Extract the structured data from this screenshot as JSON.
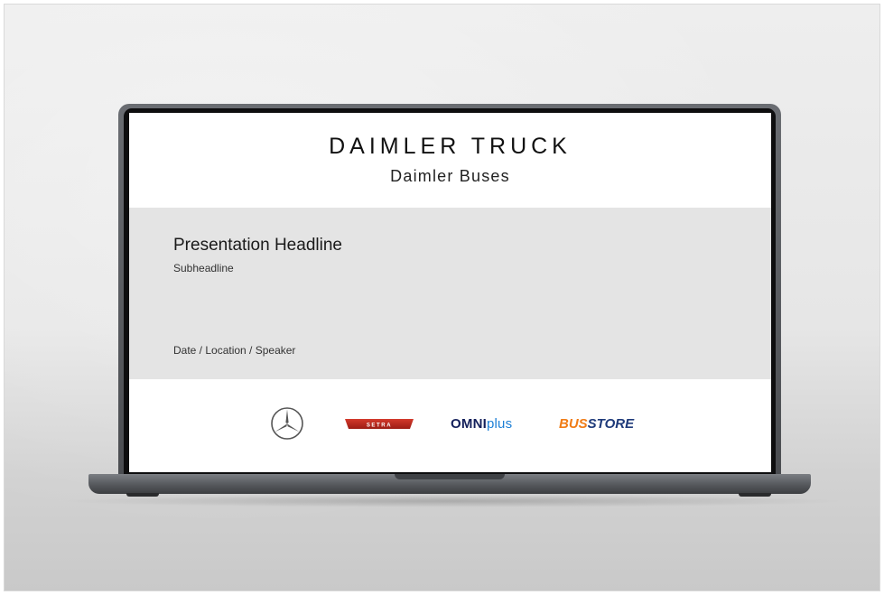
{
  "slide": {
    "brand_title": "DAIMLER TRUCK",
    "brand_subtitle": "Daimler Buses",
    "headline": "Presentation Headline",
    "subheadline": "Subheadline",
    "meta": "Date / Location / Speaker"
  },
  "logos": [
    {
      "name": "mercedes-star-logo",
      "text": ""
    },
    {
      "name": "setra-logo",
      "text": "SETRA"
    },
    {
      "name": "omniplus-logo",
      "text_main": "OMNI",
      "text_accent": "plus"
    },
    {
      "name": "busstore-logo",
      "text_main": "BUS",
      "text_accent": "STORE"
    }
  ],
  "colors": {
    "gray_band": "#e4e4e4",
    "setra_red": "#c0281e",
    "omniplus_navy": "#14205b",
    "omniplus_blue": "#1c7fd6",
    "busstore_orange": "#f07c16",
    "busstore_navy": "#1e3a7a"
  }
}
